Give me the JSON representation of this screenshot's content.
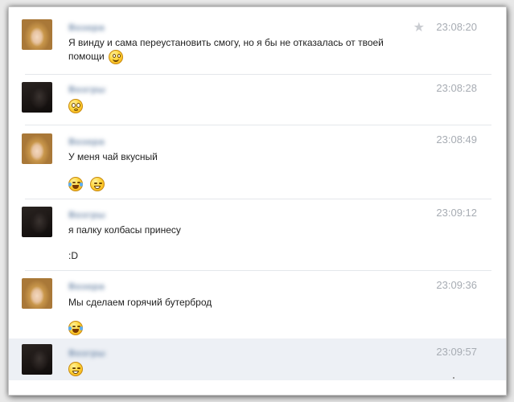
{
  "messages": [
    {
      "author": "Возера",
      "time": "23:08:20",
      "text": "Я винду и сама переустановить смогу, но я бы не отказалась от твоей помощи",
      "has_star": true,
      "emoji_inline": [
        "blush-smiley-icon"
      ]
    },
    {
      "author": "Возгры",
      "time": "23:08:28",
      "emoji_line": [
        "surprised-smiley-icon"
      ]
    },
    {
      "author": "Возера",
      "time": "23:08:49",
      "text": "У меня чай вкусный",
      "emoji_line": [
        "laughing-tears-smiley-icon",
        "grin-smiley-icon"
      ]
    },
    {
      "author": "Возгры",
      "time": "23:09:12",
      "text": "я палку колбасы принесу",
      "text2": ":D"
    },
    {
      "author": "Возера",
      "time": "23:09:36",
      "text": "Мы сделаем горячий бутерброд",
      "emoji_line": [
        "laughing-tears-smiley-icon"
      ]
    },
    {
      "author": "Возгры",
      "time": "23:09:57",
      "emoji_line": [
        "grin-smiley-icon"
      ],
      "highlighted": true
    }
  ],
  "colors": {
    "author_link": "#6f88a8",
    "time": "#a7acb3",
    "highlight_row": "#edf0f5",
    "text": "#222222"
  }
}
